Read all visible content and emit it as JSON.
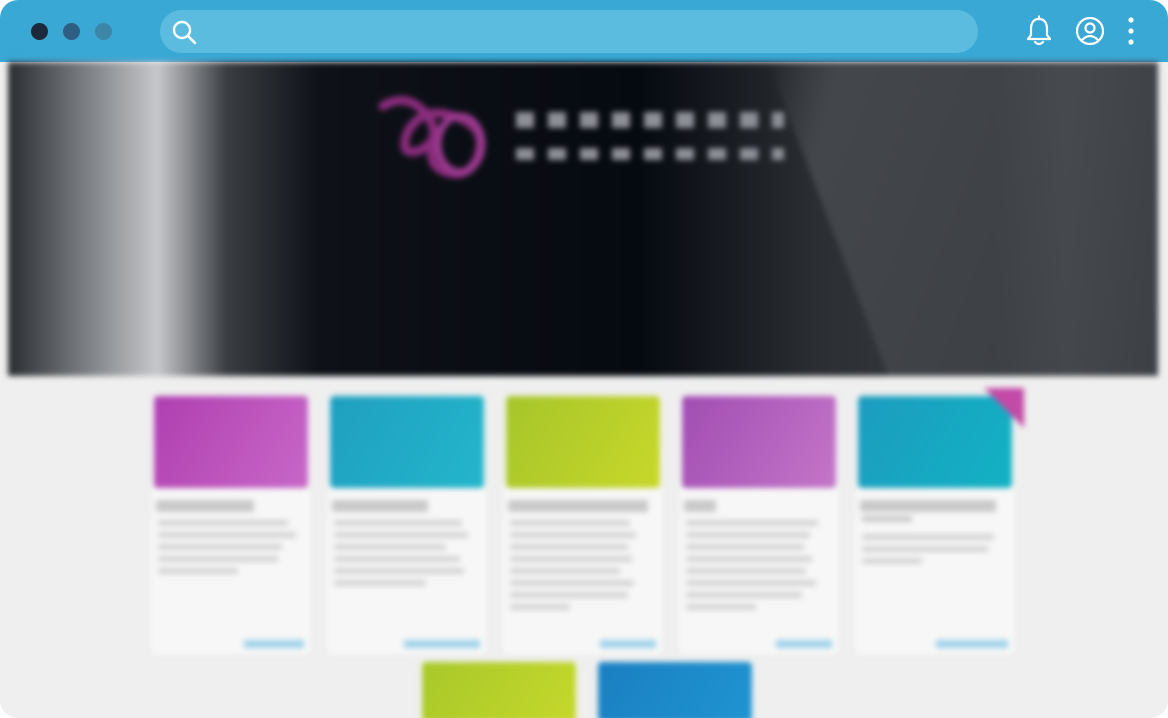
{
  "window": {
    "controls": [
      "close",
      "minimize",
      "maximize"
    ]
  },
  "toolbar": {
    "search": {
      "value": "",
      "placeholder": ""
    },
    "icons": [
      "search-icon",
      "bell-icon",
      "user-icon",
      "more-vertical-icon"
    ]
  },
  "hero": {
    "logo_icon": "brand-logo-mark",
    "title": "",
    "subtitle_line1": "",
    "subtitle_line2": ""
  },
  "courses": {
    "cards": [
      {
        "image_color": "#b03fb0",
        "image_color2": "#c867c8"
      },
      {
        "image_color": "#1f9fbf",
        "image_color2": "#23b6cc"
      },
      {
        "image_color": "#a6c52a",
        "image_color2": "#c8d82a"
      },
      {
        "image_color": "#a14db3",
        "image_color2": "#c476c8"
      },
      {
        "image_color": "#1c9cbf",
        "image_color2": "#12b2c4"
      }
    ],
    "cards_row2": [
      {
        "image_color": "#a8c82a",
        "image_color2": "#c5d82b"
      },
      {
        "image_color": "#1a7fc2",
        "image_color2": "#1f94d0"
      }
    ]
  },
  "colors": {
    "titlebar": "#3aa8d4",
    "search_bg": "#5cbce0",
    "page_bg": "#efefef",
    "link": "#9fd3ea",
    "ribbon": "#c34aa7"
  }
}
